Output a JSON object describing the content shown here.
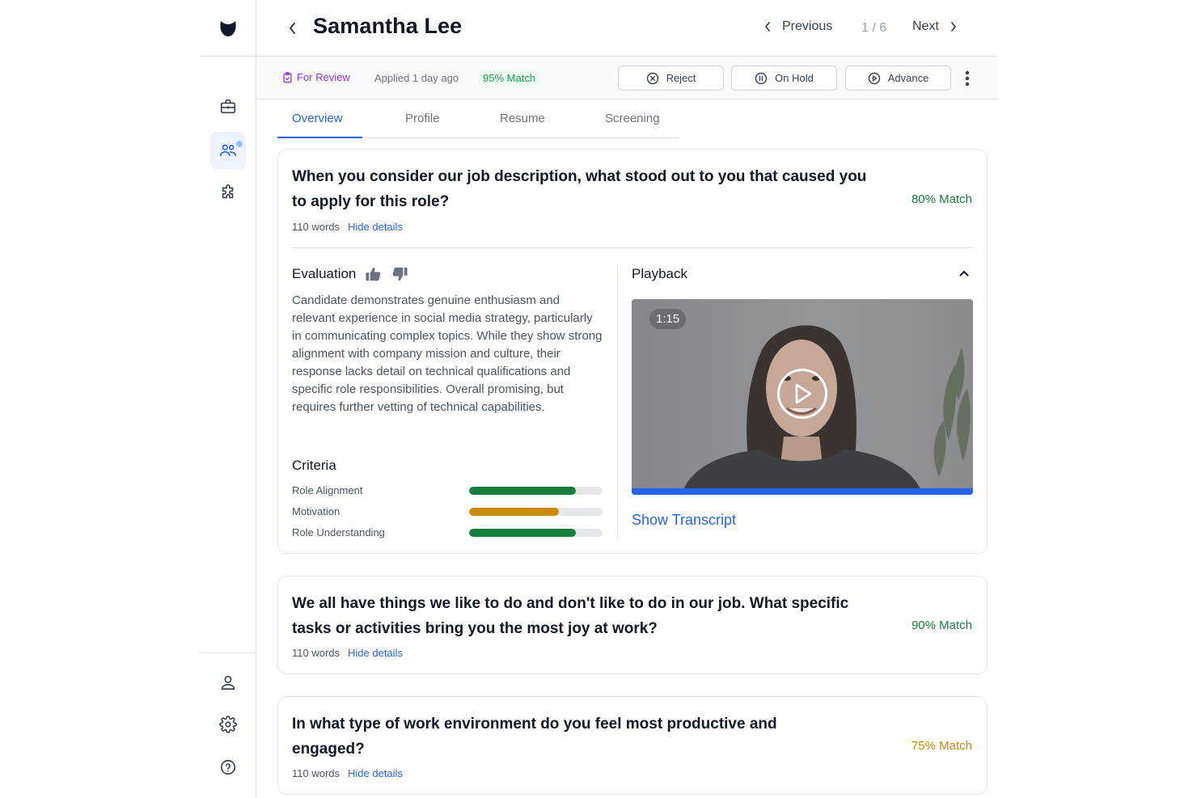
{
  "candidate": {
    "name": "Samantha Lee"
  },
  "nav": {
    "previous": "Previous",
    "count": "1 / 6",
    "next": "Next"
  },
  "status": {
    "review": "For Review",
    "applied": "Applied 1 day ago",
    "match": "95% Match",
    "actions": {
      "reject": "Reject",
      "hold": "On Hold",
      "advance": "Advance"
    }
  },
  "tabs": [
    "Overview",
    "Profile",
    "Resume",
    "Screening"
  ],
  "questions": [
    {
      "text": "When you consider our job description, what stood out to you that caused you to apply for this role?",
      "match": "80% Match",
      "words": "110 words",
      "toggle": "Hide details"
    },
    {
      "text": "We all have things we like to do and don't like to do in our job. What specific tasks or activities bring you the most joy at work?",
      "match": "90% Match",
      "words": "110 words",
      "toggle": "Hide details"
    },
    {
      "text": "In what type of work environment do you feel most productive and engaged?",
      "match": "75% Match",
      "words": "110 words",
      "toggle": "Hide details"
    }
  ],
  "evaluation": {
    "title": "Evaluation",
    "body": "Candidate demonstrates genuine enthusiasm and relevant experience in social media strategy, particularly in communicating complex topics. While they show strong alignment with company mission and culture, their response lacks detail on technical qualifications and specific role responsibilities. Overall promising, but requires further vetting of technical capabilities."
  },
  "criteria": {
    "title": "Criteria",
    "items": [
      {
        "label": "Role Alignment",
        "value": 0.8,
        "color": "#15803d"
      },
      {
        "label": "Motivation",
        "value": 0.67,
        "color": "#ca8a04"
      },
      {
        "label": "Role Understanding",
        "value": 0.8,
        "color": "#15803d"
      }
    ]
  },
  "playback": {
    "title": "Playback",
    "duration": "1:15",
    "progress": 1.0,
    "transcript": "Show Transcript"
  },
  "colors": {
    "accent": "#2563eb",
    "match_green": "#15803d",
    "match_amber": "#ca8a04",
    "review_purple": "#9333ea"
  },
  "icons": {
    "logo": "logo-icon",
    "jobs": "briefcase-icon",
    "candidates": "users-icon",
    "integrations": "puzzle-icon",
    "profile": "user-icon",
    "settings": "gear-icon",
    "help": "help-icon"
  }
}
